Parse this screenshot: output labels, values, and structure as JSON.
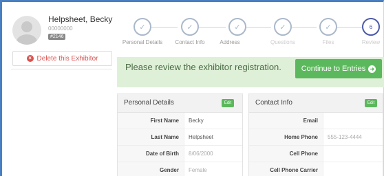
{
  "exhibitor": {
    "name": "Helpsheet, Becky",
    "code": "00000000",
    "badge": "#2146",
    "delete_label": "Delete this Exhibitor"
  },
  "wizard": {
    "steps": [
      {
        "label": "Personal Details",
        "state": "complete"
      },
      {
        "label": "Contact Info",
        "state": "complete"
      },
      {
        "label": "Address",
        "state": "complete"
      },
      {
        "label": "Questions",
        "state": "complete"
      },
      {
        "label": "Files",
        "state": "complete"
      },
      {
        "label": "Review",
        "state": "current",
        "number": "6"
      }
    ]
  },
  "banner": {
    "message": "Please review the exhibitor registration.",
    "continue_label": "Continue to Entries"
  },
  "personal": {
    "title": "Personal Details",
    "edit_label": "Edit",
    "rows": [
      {
        "label": "First Name",
        "value": "Becky"
      },
      {
        "label": "Last Name",
        "value": "Helpsheet"
      },
      {
        "label": "Date of Birth",
        "value": "8/06/2000"
      },
      {
        "label": "Gender",
        "value": "Female"
      }
    ]
  },
  "contact": {
    "title": "Contact Info",
    "edit_label": "Edit",
    "rows": [
      {
        "label": "Email",
        "value": ""
      },
      {
        "label": "Home Phone",
        "value": "555-123-4444"
      },
      {
        "label": "Cell Phone",
        "value": ""
      },
      {
        "label": "Cell Phone Carrier",
        "value": ""
      }
    ]
  },
  "colors": {
    "accent": "#5cb85c",
    "banner_bg": "#dff0d8",
    "delete": "#d9534f",
    "wizard_current": "#4b5aa8"
  }
}
